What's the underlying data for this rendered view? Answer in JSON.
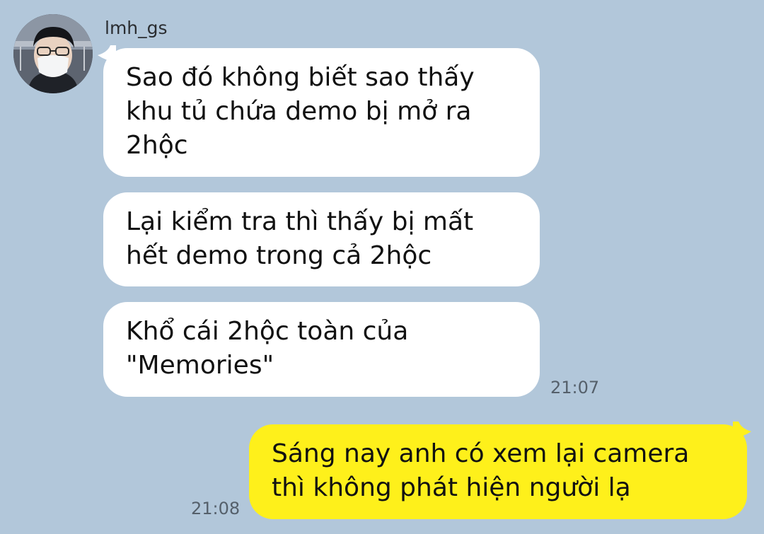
{
  "conversation": {
    "sender_name": "lmh_gs",
    "messages": [
      {
        "direction": "incoming",
        "text": "Sao đó không biết sao thấy khu tủ chứa demo bị mở ra 2hộc"
      },
      {
        "direction": "incoming",
        "text": "Lại kiểm tra thì thấy bị mất hết demo trong cả 2hộc"
      },
      {
        "direction": "incoming",
        "text": "Khổ cái 2hộc toàn của \"Memories\"",
        "time": "21:07"
      },
      {
        "direction": "outgoing",
        "text": "Sáng nay anh có xem lại camera thì không phát hiện người lạ",
        "time": "21:08"
      }
    ]
  },
  "colors": {
    "background": "#b2c7da",
    "incoming_bubble": "#ffffff",
    "outgoing_bubble": "#fef01b",
    "timestamp_text": "#55606b"
  },
  "icons": {
    "avatar": "profile-photo-person-with-glasses-and-mask"
  }
}
